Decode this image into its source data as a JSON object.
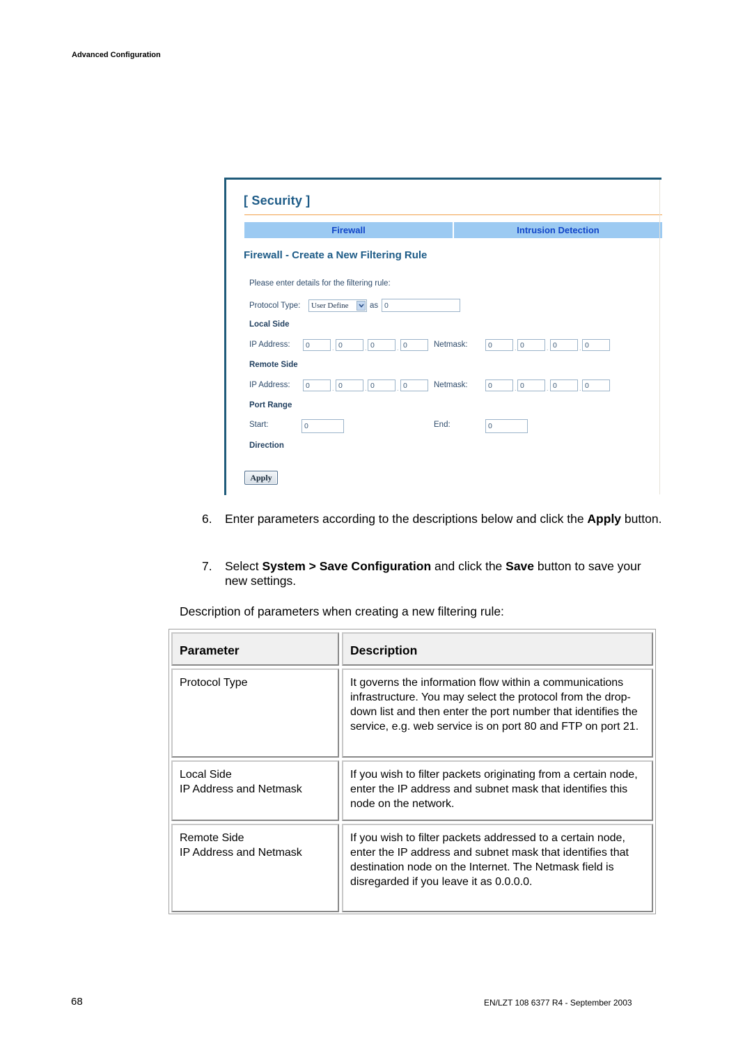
{
  "header": {
    "section_label": "Advanced Configuration"
  },
  "screenshot": {
    "section_title": "[ Security ]",
    "tabs": [
      {
        "label": "Firewall",
        "active": true
      },
      {
        "label": "Intrusion Detection",
        "active": false
      }
    ],
    "form_title": "Firewall - Create a New Filtering Rule",
    "instruction": "Please enter details for the filtering rule:",
    "protocol": {
      "label": "Protocol Type:",
      "selected": "User Define",
      "as_label": "as",
      "value": "0"
    },
    "local_side": {
      "heading": "Local Side",
      "ip_label": "IP Address:",
      "ip": [
        "0",
        "0",
        "0",
        "0"
      ],
      "netmask_label": "Netmask:",
      "netmask": [
        "0",
        "0",
        "0",
        "0"
      ]
    },
    "remote_side": {
      "heading": "Remote Side",
      "ip_label": "IP Address:",
      "ip": [
        "0",
        "0",
        "0",
        "0"
      ],
      "netmask_label": "Netmask:",
      "netmask": [
        "0",
        "0",
        "0",
        "0"
      ]
    },
    "port_range": {
      "heading": "Port Range",
      "start_label": "Start:",
      "start": "0",
      "end_label": "End:",
      "end": "0"
    },
    "direction": {
      "heading": "Direction"
    },
    "apply_label": "Apply",
    "colors": {
      "title": "#1d5b87",
      "tab_bg": "#9ccaf2",
      "tab_text": "#1246c8",
      "rule": "#f2a24a",
      "frame": "#1f5b7a"
    }
  },
  "steps": [
    {
      "num": "6.",
      "parts": [
        "Enter parameters according to the descriptions below and click the ",
        "Apply",
        " button."
      ]
    },
    {
      "num": "7.",
      "parts": [
        "Select ",
        "System > Save Configuration",
        " and click the ",
        "Save",
        " button to save your new settings."
      ]
    }
  ],
  "intro": "Description of parameters when creating a new filtering rule:",
  "table": {
    "headers": [
      "Parameter",
      "Description"
    ],
    "rows": [
      {
        "param": [
          "Protocol Type"
        ],
        "desc": "It governs the information flow within a communications infrastructure. You may select the protocol from the drop-down list and then enter the port number that identifies the service, e.g. web service is on port 80 and FTP on port 21."
      },
      {
        "param": [
          "Local Side",
          "IP Address and Netmask"
        ],
        "desc": "If you wish to filter packets originating from a certain node, enter the IP address and subnet mask that identifies this node on the network."
      },
      {
        "param": [
          "Remote Side",
          "IP Address and Netmask"
        ],
        "desc": "If you wish to filter packets addressed to a certain node, enter the IP address and subnet mask that identifies that destination node on the Internet. The Netmask field is disregarded if you leave it as 0.0.0.0."
      }
    ]
  },
  "footer": {
    "page_number": "68",
    "doc_ref": "EN/LZT 108 6377 R4 - September 2003"
  }
}
